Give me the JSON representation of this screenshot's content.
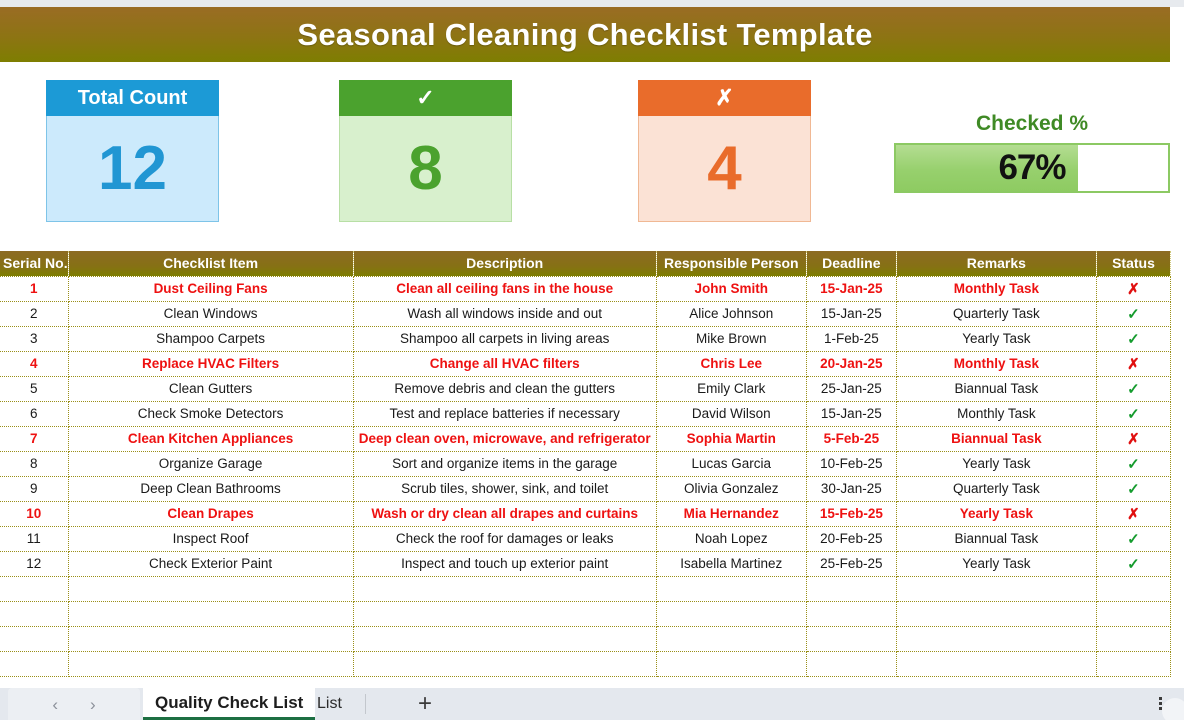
{
  "banner": {
    "title": "Seasonal Cleaning Checklist Template"
  },
  "kpis": [
    {
      "name": "total-count",
      "header": "Total Count",
      "value": "12"
    },
    {
      "name": "checked-count",
      "header": "✓",
      "value": "8"
    },
    {
      "name": "unchecked-count",
      "header": "✗",
      "value": "4"
    }
  ],
  "gauge": {
    "label": "Checked %",
    "value_text": "67%",
    "percent": 67
  },
  "table": {
    "headers": [
      "Serial No.",
      "Checklist Item",
      "Description",
      "Responsible Person",
      "Deadline",
      "Remarks",
      "Status"
    ],
    "rows": [
      {
        "sn": "1",
        "item": "Dust Ceiling Fans",
        "desc": "Clean all ceiling fans in the house",
        "resp": "John Smith",
        "deadline": "15-Jan-25",
        "remarks": "Monthly Task",
        "status": "✗",
        "flag": true
      },
      {
        "sn": "2",
        "item": "Clean Windows",
        "desc": "Wash all windows inside and out",
        "resp": "Alice Johnson",
        "deadline": "15-Jan-25",
        "remarks": "Quarterly Task",
        "status": "✓",
        "flag": false
      },
      {
        "sn": "3",
        "item": "Shampoo Carpets",
        "desc": "Shampoo all carpets in living areas",
        "resp": "Mike Brown",
        "deadline": "1-Feb-25",
        "remarks": "Yearly Task",
        "status": "✓",
        "flag": false
      },
      {
        "sn": "4",
        "item": "Replace HVAC Filters",
        "desc": "Change all HVAC filters",
        "resp": "Chris Lee",
        "deadline": "20-Jan-25",
        "remarks": "Monthly Task",
        "status": "✗",
        "flag": true
      },
      {
        "sn": "5",
        "item": "Clean Gutters",
        "desc": "Remove debris and clean the gutters",
        "resp": "Emily Clark",
        "deadline": "25-Jan-25",
        "remarks": "Biannual Task",
        "status": "✓",
        "flag": false
      },
      {
        "sn": "6",
        "item": "Check Smoke Detectors",
        "desc": "Test and replace batteries if necessary",
        "resp": "David Wilson",
        "deadline": "15-Jan-25",
        "remarks": "Monthly Task",
        "status": "✓",
        "flag": false
      },
      {
        "sn": "7",
        "item": "Clean Kitchen Appliances",
        "desc": "Deep clean oven, microwave, and refrigerator",
        "resp": "Sophia Martin",
        "deadline": "5-Feb-25",
        "remarks": "Biannual Task",
        "status": "✗",
        "flag": true
      },
      {
        "sn": "8",
        "item": "Organize Garage",
        "desc": "Sort and organize items in the garage",
        "resp": "Lucas Garcia",
        "deadline": "10-Feb-25",
        "remarks": "Yearly Task",
        "status": "✓",
        "flag": false
      },
      {
        "sn": "9",
        "item": "Deep Clean Bathrooms",
        "desc": "Scrub tiles, shower, sink, and toilet",
        "resp": "Olivia Gonzalez",
        "deadline": "30-Jan-25",
        "remarks": "Quarterly Task",
        "status": "✓",
        "flag": false
      },
      {
        "sn": "10",
        "item": "Clean Drapes",
        "desc": "Wash or dry clean all drapes and curtains",
        "resp": "Mia Hernandez",
        "deadline": "15-Feb-25",
        "remarks": "Yearly Task",
        "status": "✗",
        "flag": true
      },
      {
        "sn": "11",
        "item": "Inspect Roof",
        "desc": "Check the roof for damages or leaks",
        "resp": "Noah Lopez",
        "deadline": "20-Feb-25",
        "remarks": "Biannual Task",
        "status": "✓",
        "flag": false
      },
      {
        "sn": "12",
        "item": "Check Exterior Paint",
        "desc": "Inspect and touch up exterior paint",
        "resp": "Isabella Martinez",
        "deadline": "25-Feb-25",
        "remarks": "Yearly Task",
        "status": "✓",
        "flag": false
      },
      {
        "sn": "",
        "item": "",
        "desc": "",
        "resp": "",
        "deadline": "",
        "remarks": "",
        "status": "",
        "flag": false
      },
      {
        "sn": "",
        "item": "",
        "desc": "",
        "resp": "",
        "deadline": "",
        "remarks": "",
        "status": "",
        "flag": false
      },
      {
        "sn": "",
        "item": "",
        "desc": "",
        "resp": "",
        "deadline": "",
        "remarks": "",
        "status": "",
        "flag": false
      },
      {
        "sn": "",
        "item": "",
        "desc": "",
        "resp": "",
        "deadline": "",
        "remarks": "",
        "status": "",
        "flag": false
      }
    ]
  },
  "tabbar": {
    "prev_label": "‹",
    "next_label": "›",
    "tabs": [
      {
        "label": "Quality Check List",
        "active": true
      },
      {
        "label": "List",
        "active": false
      }
    ],
    "add_label": "+",
    "menu_label": "more-options"
  },
  "colors": {
    "banner_top": "#9a6c24",
    "banner_bottom": "#7e7e01",
    "blue": "#1c9ad6",
    "green": "#4ba22e",
    "orange": "#e96c2b",
    "flag_red": "#ee1111",
    "check_green": "#159c2e",
    "gridline": "#9a8f18"
  }
}
